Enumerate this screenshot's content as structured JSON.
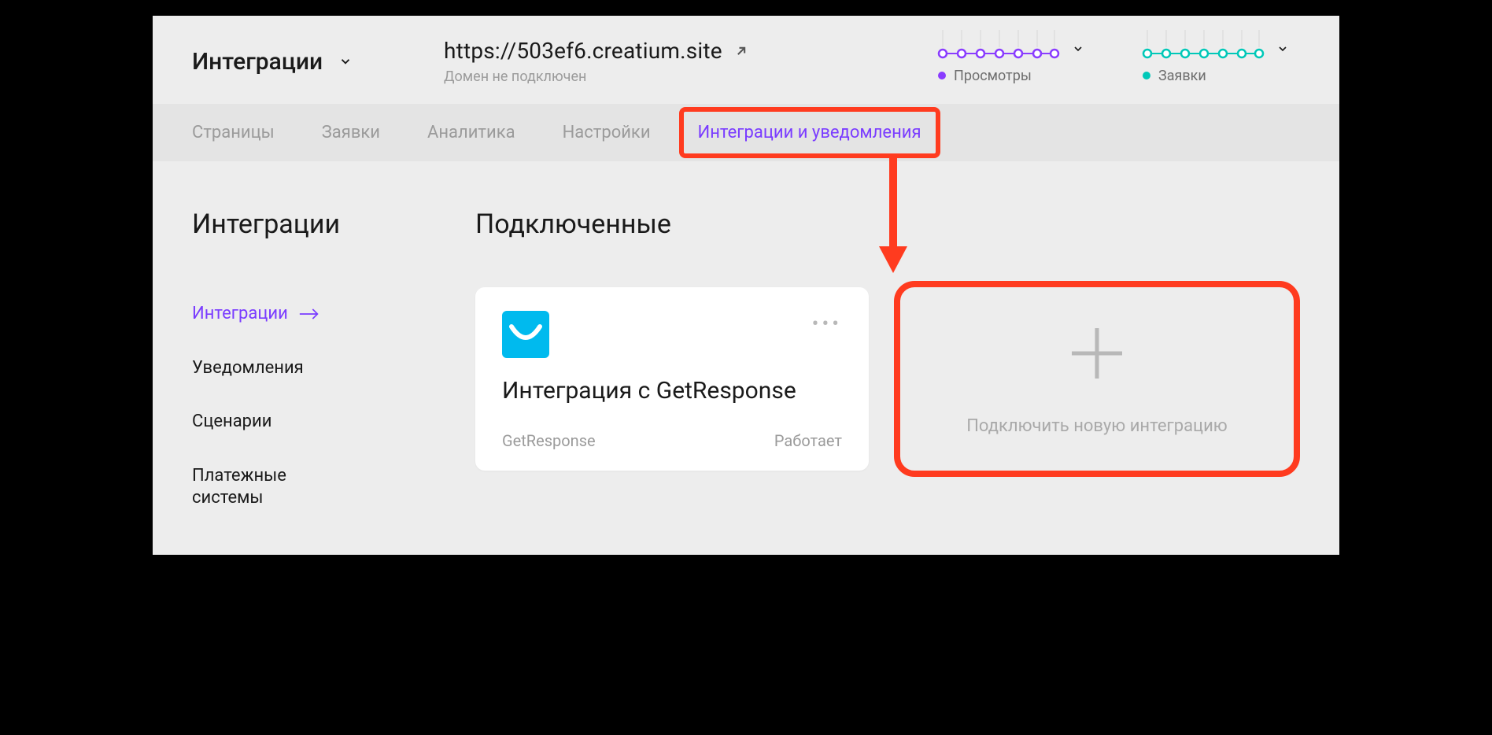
{
  "header": {
    "title": "Интеграции",
    "site_url": "https://503ef6.creatium.site",
    "domain_status": "Домен не подключен"
  },
  "stats": {
    "views": {
      "label": "Просмотры",
      "color": "#8a3cff"
    },
    "requests": {
      "label": "Заявки",
      "color": "#00c8b8"
    }
  },
  "tabs": {
    "pages": "Страницы",
    "requests": "Заявки",
    "analytics": "Аналитика",
    "settings": "Настройки",
    "integrations": "Интеграции и уведомления"
  },
  "sidebar": {
    "title": "Интеграции",
    "items": {
      "integrations": "Интеграции",
      "notifications": "Уведомления",
      "scenarios": "Сценарии",
      "payments": "Платежные системы"
    }
  },
  "content": {
    "section_title": "Подключенные",
    "card": {
      "title": "Интеграция с GetResponse",
      "provider": "GetResponse",
      "status": "Работает"
    },
    "add_label": "Подключить новую интеграцию"
  },
  "annotation": {
    "highlight_color": "#ff3b1f"
  }
}
